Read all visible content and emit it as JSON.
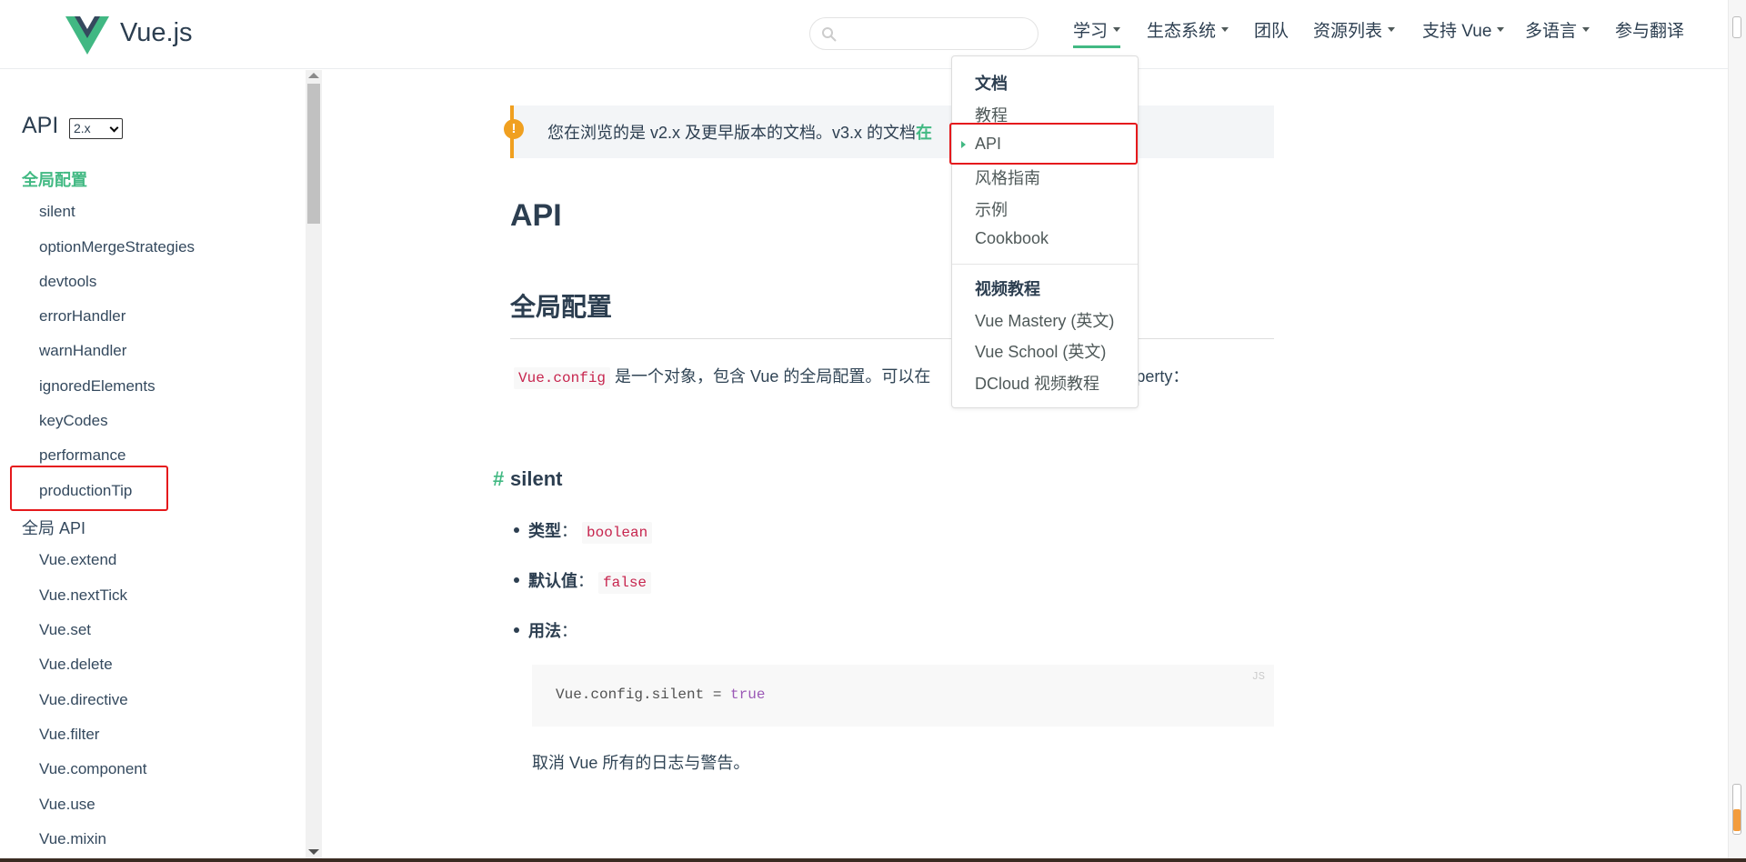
{
  "header": {
    "brand": "Vue.js",
    "search_placeholder": "",
    "nav": [
      {
        "label": "学习",
        "dropdown": true,
        "active": true
      },
      {
        "label": "生态系统",
        "dropdown": true
      },
      {
        "label": "团队",
        "dropdown": false
      },
      {
        "label": "资源列表",
        "dropdown": true
      },
      {
        "label": "支持 Vue",
        "dropdown": true
      },
      {
        "label": "多语言",
        "dropdown": true
      },
      {
        "label": "参与翻译",
        "dropdown": false
      }
    ]
  },
  "dropdown": {
    "section1_title": "文档",
    "section1_items": [
      "教程",
      "API",
      "风格指南",
      "示例",
      "Cookbook"
    ],
    "section2_title": "视频教程",
    "section2_items": [
      "Vue Mastery (英文)",
      "Vue School (英文)",
      "DCloud 视频教程"
    ]
  },
  "sidebar": {
    "title": "API",
    "version": "2.x",
    "section_global_config": "全局配置",
    "global_config_items": [
      "silent",
      "optionMergeStrategies",
      "devtools",
      "errorHandler",
      "warnHandler",
      "ignoredElements",
      "keyCodes",
      "performance",
      "productionTip"
    ],
    "section_global_api": "全局 API",
    "global_api_items": [
      "Vue.extend",
      "Vue.nextTick",
      "Vue.set",
      "Vue.delete",
      "Vue.directive",
      "Vue.filter",
      "Vue.component",
      "Vue.use",
      "Vue.mixin"
    ]
  },
  "content": {
    "notice_text": "您在浏览的是 v2.x 及更早版本的文档。v3.x 的文档",
    "notice_link": "在",
    "h1": "API",
    "h2": "全局配置",
    "intro_code": "Vue.config",
    "intro_text": "是一个对象，包含 Vue 的全局配置。可以在",
    "intro_tail": "roperty：",
    "h3_hash": "#",
    "h3": "silent",
    "type_label": "类型",
    "type_value": "boolean",
    "default_label": "默认值",
    "default_value": "false",
    "usage_label": "用法",
    "colon": "：",
    "code_lang": "JS",
    "code_text": "Vue.config.silent = ",
    "code_keyword": "true",
    "description": "取消 Vue 所有的日志与警告。"
  },
  "colors": {
    "accent": "#42b983",
    "highlight_box": "#e5191c",
    "warning": "#f0a020"
  }
}
